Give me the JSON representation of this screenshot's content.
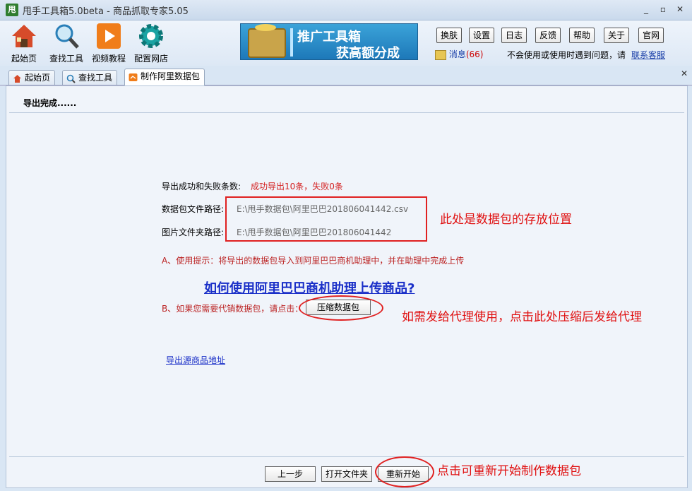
{
  "titlebar": {
    "logo": "甩",
    "title": "甩手工具箱5.0beta - 商品抓取专家5.05"
  },
  "toolbar": {
    "tools": [
      {
        "label": "起始页",
        "icon": "home-icon"
      },
      {
        "label": "查找工具",
        "icon": "magnifier-icon"
      },
      {
        "label": "视频教程",
        "icon": "play-icon"
      },
      {
        "label": "配置网店",
        "icon": "gear-icon"
      }
    ],
    "banner": {
      "line1": "推广工具箱",
      "line2": "获高额分成"
    },
    "buttons": [
      "换肤",
      "设置",
      "日志",
      "反馈",
      "帮助",
      "关于",
      "官网"
    ],
    "message_label": "消息",
    "message_count": "(66)",
    "help_text": "不会使用或使用时遇到问题，请",
    "help_link": "联系客服"
  },
  "tabs": [
    {
      "label": "起始页",
      "icon": "home-icon"
    },
    {
      "label": "查找工具",
      "icon": "magnifier-icon"
    },
    {
      "label": "制作阿里数据包",
      "icon": "package-icon",
      "active": true
    }
  ],
  "content": {
    "status": "导出完成......",
    "result_label": "导出成功和失败条数:",
    "result_value": "成功导出10条，失败0条",
    "pkg_path_label": "数据包文件路径:",
    "pkg_path_value": "E:\\甩手数据包\\阿里巴巴201806041442.csv",
    "img_path_label": "图片文件夹路径:",
    "img_path_value": "E:\\甩手数据包\\阿里巴巴201806041442",
    "tip_a": "A、使用提示：将导出的数据包导入到阿里巴巴商机助理中，并在助理中完成上传",
    "how_to_link": "如何使用阿里巴巴商机助理上传商品?",
    "tip_b": "B、如果您需要代销数据包，请点击：",
    "compress_button": "压缩数据包",
    "source_link": "导出源商品地址",
    "annotation_1": "此处是数据包的存放位置",
    "annotation_2": "如需发给代理使用，点击此处压缩后发给代理",
    "annotation_3": "点击可重新开始制作数据包"
  },
  "footer": {
    "prev_button": "上一步",
    "open_folder_button": "打开文件夹",
    "restart_button": "重新开始"
  },
  "colors": {
    "annotation_red": "#e01010",
    "link_blue": "#1a2fc8",
    "background": "#d9e6f4"
  }
}
